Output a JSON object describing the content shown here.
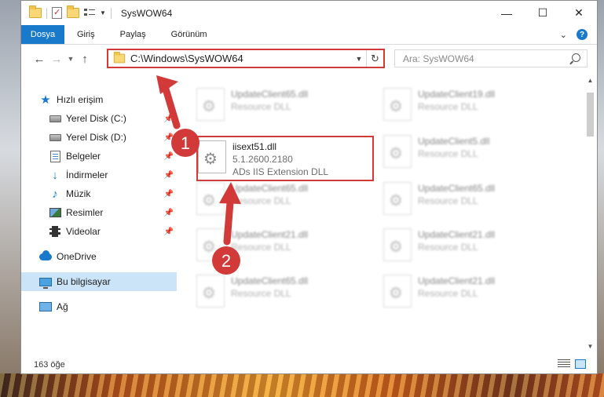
{
  "window": {
    "title": "SysWOW64"
  },
  "ribbon": {
    "tabs": [
      "Dosya",
      "Giriş",
      "Paylaş",
      "Görünüm"
    ]
  },
  "nav": {
    "address": "C:\\Windows\\SysWOW64",
    "search_placeholder": "Ara: SysWOW64"
  },
  "sidebar": {
    "items": [
      {
        "label": "Hızlı erişim",
        "icon": "star-icon"
      },
      {
        "label": "Yerel Disk (C:)",
        "icon": "drive-icon"
      },
      {
        "label": "Yerel Disk (D:)",
        "icon": "drive-icon"
      },
      {
        "label": "Belgeler",
        "icon": "documents-icon"
      },
      {
        "label": "İndirmeler",
        "icon": "download-icon"
      },
      {
        "label": "Müzik",
        "icon": "music-icon"
      },
      {
        "label": "Resimler",
        "icon": "pictures-icon"
      },
      {
        "label": "Videolar",
        "icon": "video-icon"
      },
      {
        "label": "OneDrive",
        "icon": "cloud-icon"
      },
      {
        "label": "Bu bilgisayar",
        "icon": "computer-icon"
      },
      {
        "label": "Ağ",
        "icon": "network-icon"
      }
    ]
  },
  "files": {
    "highlighted": {
      "name": "iisext51.dll",
      "version": "5.1.2600.2180",
      "description": "ADs IIS Extension DLL"
    },
    "background": [
      {
        "name": "UpdateClient65.dll",
        "description": "Resource DLL"
      },
      {
        "name": "UpdateClient19.dll",
        "description": "Resource DLL"
      },
      {
        "name": "UpdateClient5.dll",
        "description": "Resource DLL"
      },
      {
        "name": "UpdateClient65.dll",
        "description": "Resource DLL"
      },
      {
        "name": "UpdateClient65.dll",
        "description": "Resource DLL"
      },
      {
        "name": "UpdateClient21.dll",
        "description": "Resource DLL"
      },
      {
        "name": "UpdateClient21.dll",
        "description": "Resource DLL"
      },
      {
        "name": "UpdateClient65.dll",
        "description": "Resource DLL"
      },
      {
        "name": "UpdateClient21.dll",
        "description": "Resource DLL"
      }
    ]
  },
  "status": {
    "count": "163 öğe"
  },
  "annotations": {
    "step1": "1",
    "step2": "2",
    "color": "#d23a3a"
  }
}
